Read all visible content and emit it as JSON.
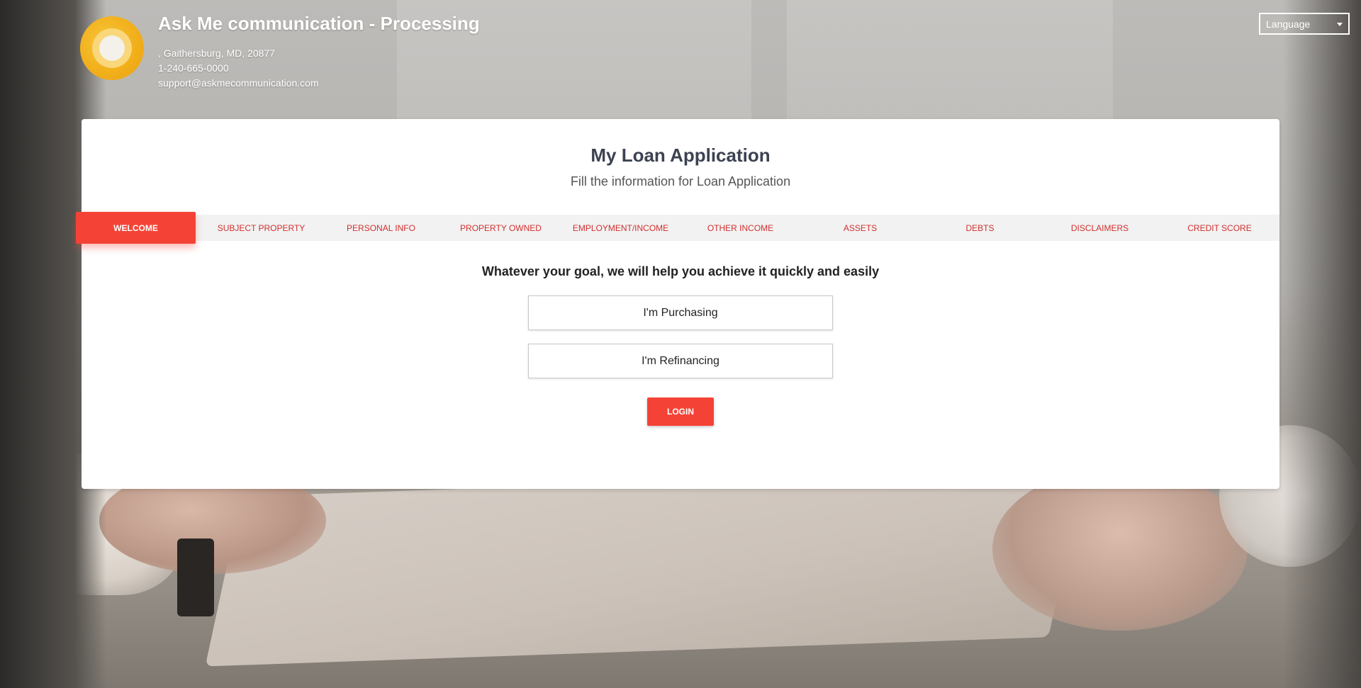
{
  "header": {
    "company_name": "Ask Me communication - Processing",
    "address": ", Gaithersburg, MD, 20877",
    "phone": "1-240-665-0000",
    "email": "support@askmecommunication.com",
    "language_label": "Language",
    "logo_icon": "logo-circle-icon"
  },
  "card": {
    "title": "My Loan Application",
    "subtitle": "Fill the information for Loan Application"
  },
  "tabs": [
    {
      "label": "WELCOME",
      "active": true
    },
    {
      "label": "SUBJECT PROPERTY",
      "active": false
    },
    {
      "label": "PERSONAL INFO",
      "active": false
    },
    {
      "label": "PROPERTY OWNED",
      "active": false
    },
    {
      "label": "EMPLOYMENT/INCOME",
      "active": false
    },
    {
      "label": "OTHER INCOME",
      "active": false
    },
    {
      "label": "ASSETS",
      "active": false
    },
    {
      "label": "DEBTS",
      "active": false
    },
    {
      "label": "DISCLAIMERS",
      "active": false
    },
    {
      "label": "CREDIT SCORE",
      "active": false
    }
  ],
  "welcome": {
    "goal_text": "Whatever your goal, we will help you achieve it quickly and easily",
    "purchasing_label": "I'm Purchasing",
    "refinancing_label": "I'm Refinancing",
    "login_label": "LOGIN"
  },
  "colors": {
    "accent": "#f44336",
    "tab_text": "#d32f2f",
    "title_text": "#3c4252",
    "logo": "#f2b01b"
  }
}
